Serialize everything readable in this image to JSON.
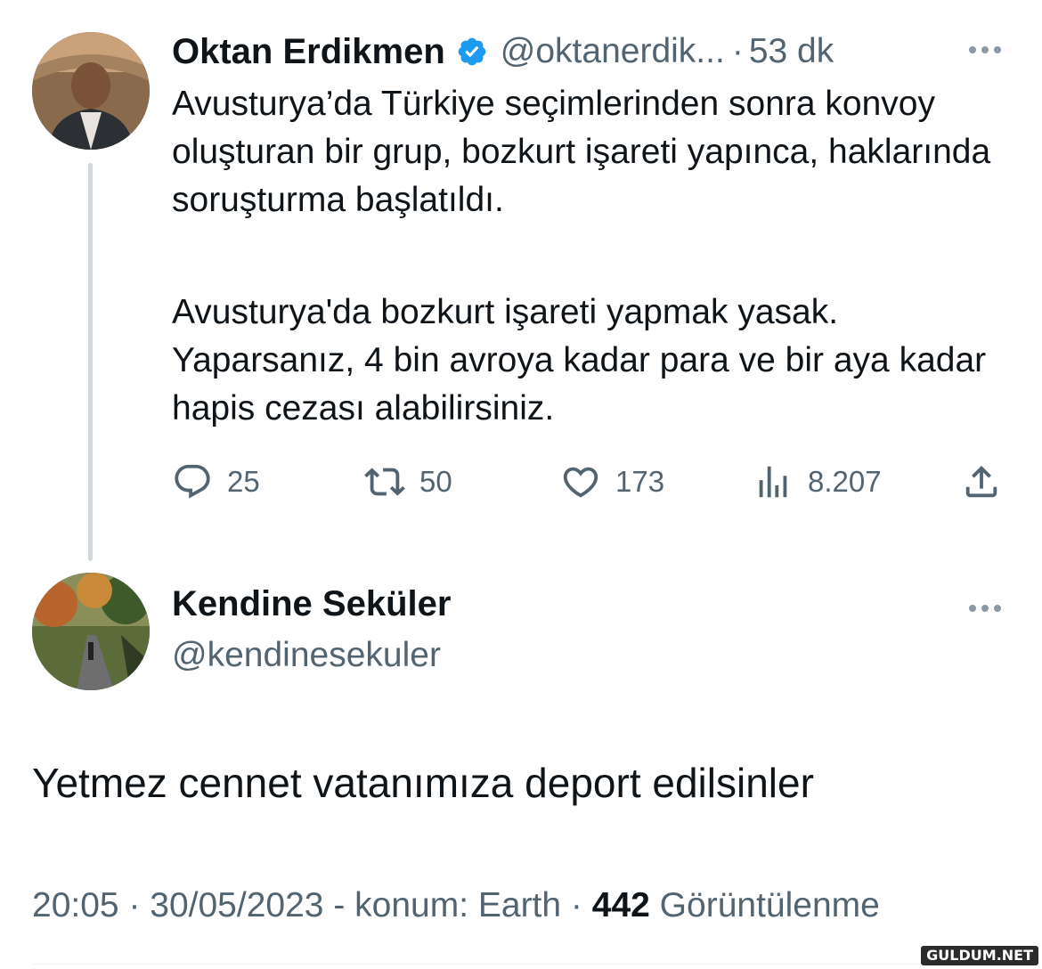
{
  "tweet1": {
    "author_name": "Oktan Erdikmen",
    "handle": "@oktanerdik...",
    "separator": "·",
    "time": "53 dk",
    "paragraph1": "Avusturya’da Türkiye seçimlerinden sonra konvoy oluşturan bir grup, bozkurt işareti yapınca, haklarında soruşturma başlatıldı.",
    "paragraph2": "Avusturya'da bozkurt işareti yapmak yasak. Yaparsanız, 4 bin avroya kadar para ve bir aya kadar hapis cezası alabilirsiniz.",
    "actions": {
      "replies": "25",
      "retweets": "50",
      "likes": "173",
      "views": "8.207"
    },
    "icons": [
      "reply-icon",
      "retweet-icon",
      "like-icon",
      "views-icon",
      "share-icon",
      "verified-badge-icon",
      "more-options-icon"
    ]
  },
  "tweet2": {
    "author_name": "Kendine Seküler",
    "handle": "@kendinesekuler",
    "text": "Yetmez cennet vatanımıza deport edilsinler",
    "meta": {
      "time": "20:05",
      "sep1": " · ",
      "date": "30/05/2023",
      "location": " - konum: Earth",
      "sep2": " · ",
      "view_count": "442",
      "view_label": " Görüntülenme"
    }
  },
  "watermark": "GULDUM.NET",
  "colors": {
    "text_primary": "#0f1419",
    "text_secondary": "#536471",
    "verified_blue": "#1d9bf0",
    "thread_line": "#cfd9de"
  }
}
